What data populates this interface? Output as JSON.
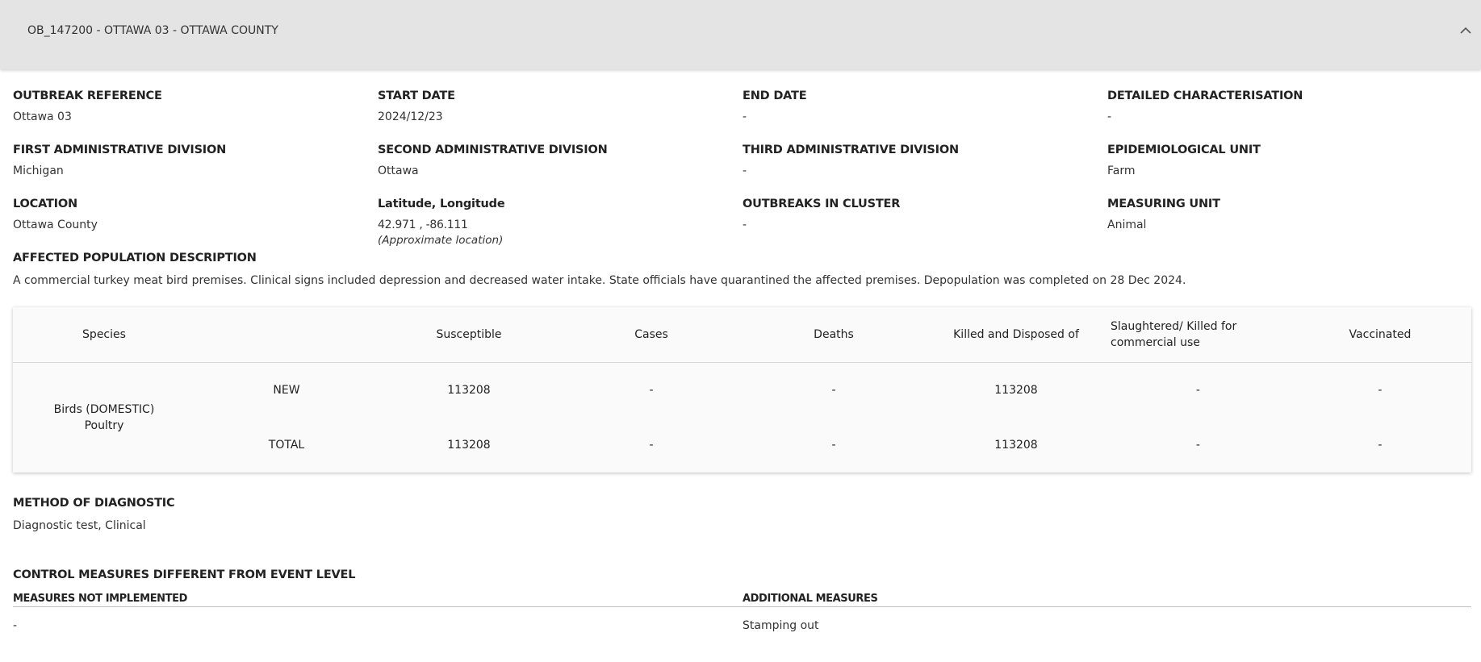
{
  "header": {
    "title": "OB_147200 - OTTAWA 03 - OTTAWA COUNTY"
  },
  "fields": [
    {
      "label": "OUTBREAK REFERENCE",
      "value": "Ottawa 03"
    },
    {
      "label": "START DATE",
      "value": "2024/12/23"
    },
    {
      "label": "END DATE",
      "value": "-"
    },
    {
      "label": "DETAILED CHARACTERISATION",
      "value": "-"
    },
    {
      "label": "FIRST ADMINISTRATIVE DIVISION",
      "value": "Michigan"
    },
    {
      "label": "SECOND ADMINISTRATIVE DIVISION",
      "value": "Ottawa"
    },
    {
      "label": "THIRD ADMINISTRATIVE DIVISION",
      "value": "-"
    },
    {
      "label": "EPIDEMIOLOGICAL UNIT",
      "value": "Farm"
    },
    {
      "label": "LOCATION",
      "value": "Ottawa County"
    },
    {
      "label": "Latitude, Longitude",
      "value": "42.971 , -86.111",
      "note": "(Approximate location)"
    },
    {
      "label": "OUTBREAKS IN CLUSTER",
      "value": "-"
    },
    {
      "label": "MEASURING UNIT",
      "value": "Animal"
    }
  ],
  "affected_population": {
    "label": "AFFECTED POPULATION DESCRIPTION",
    "text": "A commercial turkey meat bird premises. Clinical signs included depression and decreased water intake. State officials have quarantined the affected premises. Depopulation was completed on 28 Dec 2024."
  },
  "table": {
    "headers": [
      "Species",
      "",
      "Susceptible",
      "Cases",
      "Deaths",
      "Killed and Disposed of",
      "Slaughtered/ Killed for commercial use",
      "Vaccinated"
    ],
    "species_line1": "Birds (DOMESTIC)",
    "species_line2": "Poultry",
    "rows": [
      [
        "NEW",
        "113208",
        "-",
        "-",
        "113208",
        "-",
        "-"
      ],
      [
        "TOTAL",
        "113208",
        "-",
        "-",
        "113208",
        "-",
        "-"
      ]
    ]
  },
  "method": {
    "label": "METHOD OF DIAGNOSTIC",
    "value": "Diagnostic test, Clinical"
  },
  "control": {
    "label": "CONTROL MEASURES DIFFERENT FROM EVENT LEVEL",
    "not_implemented_label": "MEASURES NOT IMPLEMENTED",
    "not_implemented_value": "-",
    "additional_label": "ADDITIONAL MEASURES",
    "additional_value": "Stamping out"
  }
}
